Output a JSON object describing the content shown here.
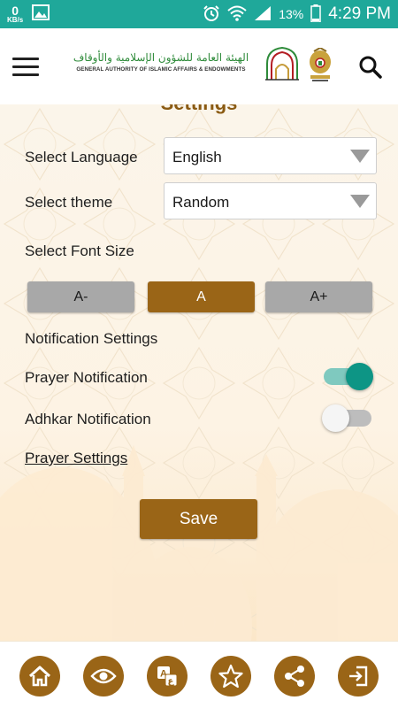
{
  "status_bar": {
    "speed_value": "0",
    "speed_unit": "KB/s",
    "battery_percent": "13%",
    "time": "4:29 PM"
  },
  "header": {
    "logo_arabic": "الهيئة العامة للشؤون الإسلامية والأوقاف",
    "logo_english": "GENERAL AUTHORITY OF ISLAMIC AFFAIRS & ENDOWMENTS"
  },
  "settings": {
    "title": "Settings",
    "language_label": "Select Language",
    "language_value": "English",
    "theme_label": "Select theme",
    "theme_value": "Random",
    "font_size_label": "Select Font Size",
    "font_buttons": [
      "A-",
      "A",
      "A+"
    ],
    "font_selected": "A",
    "notification_heading": "Notification Settings",
    "prayer_notification_label": "Prayer Notification",
    "prayer_notification_on": true,
    "adhkar_notification_label": "Adhkar Notification",
    "adhkar_notification_on": false,
    "prayer_settings_link": "Prayer Settings",
    "save_label": "Save"
  },
  "colors": {
    "status_bar": "#1fa89a",
    "accent_gold": "#9a6517",
    "title_brown": "#8a5a12",
    "toggle_on": "#0d9585"
  },
  "bottom_nav": [
    "home-icon",
    "eye-icon",
    "translate-icon",
    "star-icon",
    "share-icon",
    "exit-icon"
  ]
}
